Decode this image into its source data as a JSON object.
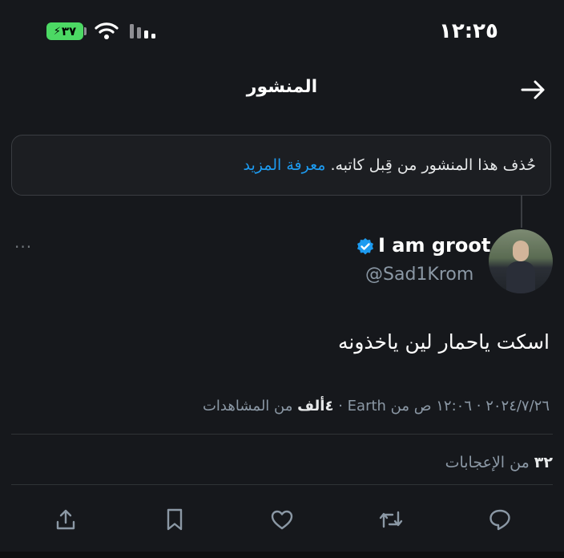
{
  "status_bar": {
    "time": "١٢:٢٥",
    "battery": "٣٧"
  },
  "header": {
    "title": "المنشور"
  },
  "notice": {
    "text": "حُذف هذا المنشور من قِبل كاتبه.",
    "link": "معرفة المزيد"
  },
  "author": {
    "display_name": "I am groot",
    "handle": "@Sad1Krom"
  },
  "tweet": {
    "text": "اسكت ياحمار لين ياخذونه",
    "date": "٢٠٢٤/٧/٢٦",
    "time": "١٢:٠٦ ص",
    "source": "من Earth",
    "views_count": "٤ألف",
    "views_label": "من المشاهدات",
    "likes_count": "٣٢",
    "likes_label": "من الإعجابات"
  },
  "more_label": "···",
  "colors": {
    "background": "#16181c",
    "accent": "#1d9bf0",
    "muted": "#8b98a5",
    "battery": "#4cd964"
  },
  "icons": [
    "wifi-icon",
    "signal-icon",
    "back-arrow-icon",
    "verified-badge-icon",
    "reply-icon",
    "repost-icon",
    "like-icon",
    "bookmark-icon",
    "share-icon"
  ]
}
